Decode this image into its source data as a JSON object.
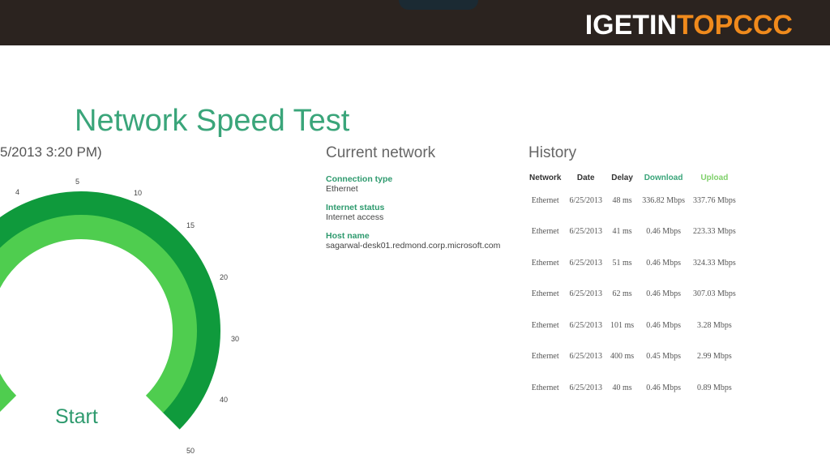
{
  "branding": {
    "logo_part1": "IGETIN",
    "logo_part2": "TOPCCC"
  },
  "app": {
    "title": "Network Speed Test",
    "subtitle": "5/2013 3:20 PM)"
  },
  "gauge": {
    "tick_labels": [
      "4",
      "5",
      "10",
      "15",
      "20",
      "30",
      "40",
      "50"
    ],
    "start_label": "Start",
    "colors": {
      "outer": "#0f9a3c",
      "inner": "#4fcd4f"
    }
  },
  "current_network": {
    "heading": "Current network",
    "fields": [
      {
        "label": "Connection type",
        "value": "Ethernet"
      },
      {
        "label": "Internet status",
        "value": "Internet access"
      },
      {
        "label": "Host name",
        "value": "sagarwal-desk01.redmond.corp.microsoft.com"
      }
    ]
  },
  "history": {
    "heading": "History",
    "columns": [
      "Network",
      "Date",
      "Delay",
      "Download",
      "Upload"
    ],
    "rows": [
      [
        "Ethernet",
        "6/25/2013",
        "48 ms",
        "336.82 Mbps",
        "337.76 Mbps"
      ],
      [
        "Ethernet",
        "6/25/2013",
        "41 ms",
        "0.46 Mbps",
        "223.33 Mbps"
      ],
      [
        "Ethernet",
        "6/25/2013",
        "51 ms",
        "0.46 Mbps",
        "324.33 Mbps"
      ],
      [
        "Ethernet",
        "6/25/2013",
        "62 ms",
        "0.46 Mbps",
        "307.03 Mbps"
      ],
      [
        "Ethernet",
        "6/25/2013",
        "101 ms",
        "0.46 Mbps",
        "3.28 Mbps"
      ],
      [
        "Ethernet",
        "6/25/2013",
        "400 ms",
        "0.45 Mbps",
        "2.99 Mbps"
      ],
      [
        "Ethernet",
        "6/25/2013",
        "40 ms",
        "0.46 Mbps",
        "0.89 Mbps"
      ]
    ]
  }
}
